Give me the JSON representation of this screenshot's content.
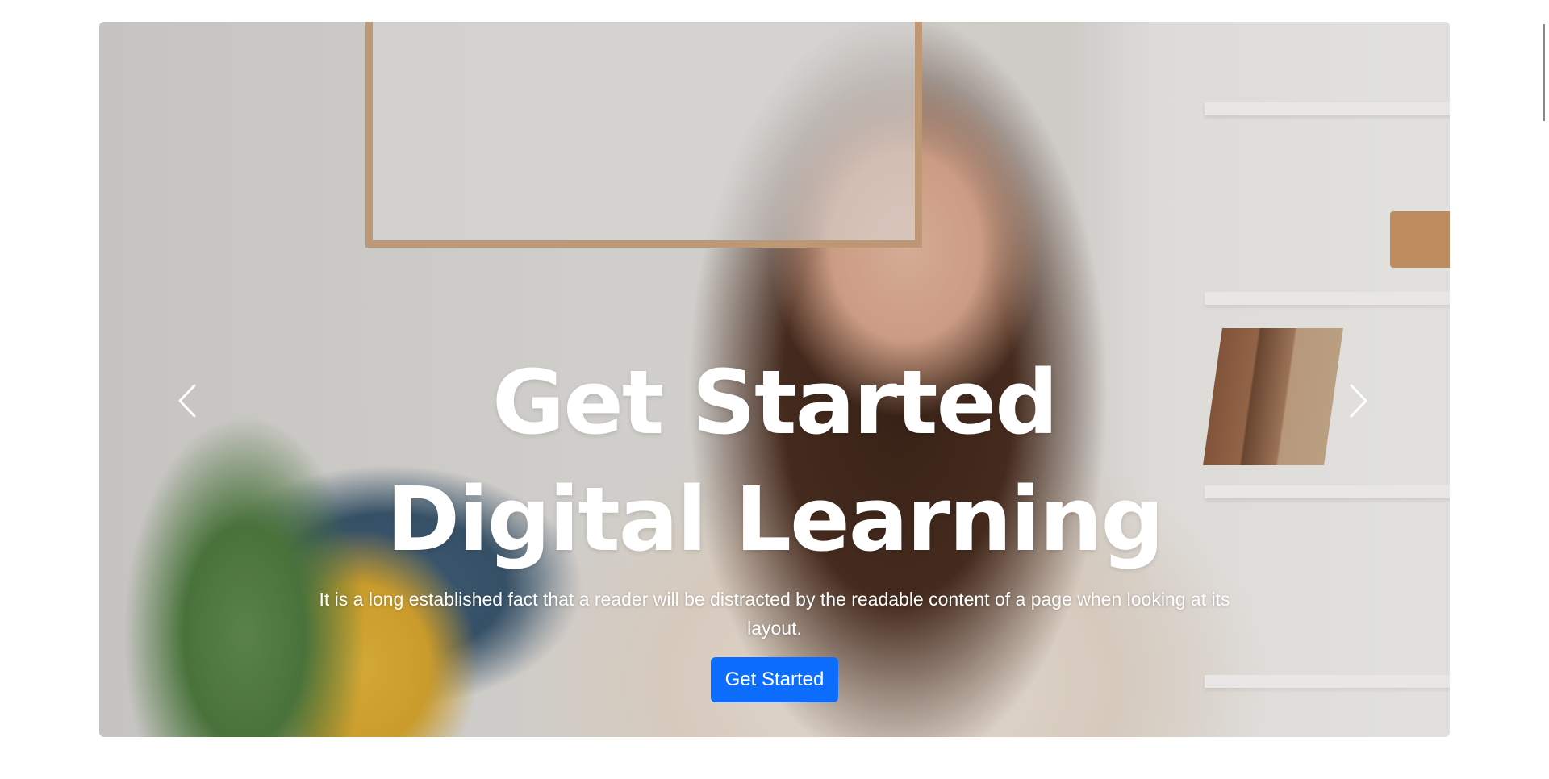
{
  "hero": {
    "title": "Get Started Digital Learning",
    "text": "It is a long established fact that a reader will be distracted by the readable content of a page when looking at its layout.",
    "button_label": "Get Started"
  },
  "carousel": {
    "prev_icon": "chevron-left-icon",
    "next_icon": "chevron-right-icon"
  },
  "colors": {
    "accent": "#0d6efd",
    "hero_text": "#ffffff",
    "page_background": "#ffffff"
  }
}
